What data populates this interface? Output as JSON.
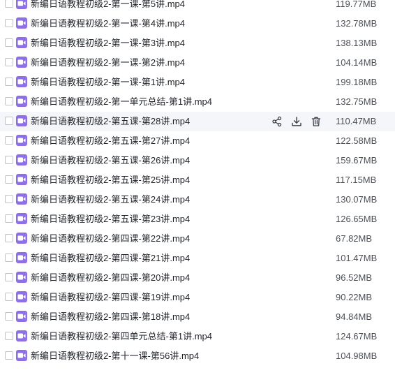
{
  "files": [
    {
      "name": "新编日语教程初级2-第一课-第5讲.mp4",
      "size": "119.77MB"
    },
    {
      "name": "新编日语教程初级2-第一课-第4讲.mp4",
      "size": "132.78MB"
    },
    {
      "name": "新编日语教程初级2-第一课-第3讲.mp4",
      "size": "138.13MB"
    },
    {
      "name": "新编日语教程初级2-第一课-第2讲.mp4",
      "size": "104.14MB"
    },
    {
      "name": "新编日语教程初级2-第一课-第1讲.mp4",
      "size": "199.18MB"
    },
    {
      "name": "新编日语教程初级2-第一单元总结-第1讲.mp4",
      "size": "132.75MB"
    },
    {
      "name": "新编日语教程初级2-第五课-第28讲.mp4",
      "size": "110.47MB"
    },
    {
      "name": "新编日语教程初级2-第五课-第27讲.mp4",
      "size": "122.58MB"
    },
    {
      "name": "新编日语教程初级2-第五课-第26讲.mp4",
      "size": "159.67MB"
    },
    {
      "name": "新编日语教程初级2-第五课-第25讲.mp4",
      "size": "117.15MB"
    },
    {
      "name": "新编日语教程初级2-第五课-第24讲.mp4",
      "size": "130.07MB"
    },
    {
      "name": "新编日语教程初级2-第五课-第23讲.mp4",
      "size": "126.65MB"
    },
    {
      "name": "新编日语教程初级2-第四课-第22讲.mp4",
      "size": "67.82MB"
    },
    {
      "name": "新编日语教程初级2-第四课-第21讲.mp4",
      "size": "101.47MB"
    },
    {
      "name": "新编日语教程初级2-第四课-第20讲.mp4",
      "size": "96.52MB"
    },
    {
      "name": "新编日语教程初级2-第四课-第19讲.mp4",
      "size": "90.22MB"
    },
    {
      "name": "新编日语教程初级2-第四课-第18讲.mp4",
      "size": "94.84MB"
    },
    {
      "name": "新编日语教程初级2-第四单元总结-第1讲.mp4",
      "size": "124.67MB"
    },
    {
      "name": "新编日语教程初级2-第十一课-第56讲.mp4",
      "size": "104.98MB"
    }
  ],
  "hovered_row": 6,
  "row_actions": [
    "share-icon",
    "download-icon",
    "delete-icon"
  ],
  "colors": {
    "file_icon": "#8f6fe8",
    "hover_bg": "#f5f6fa",
    "text": "#1f2329",
    "size_text": "#4a4f57"
  }
}
